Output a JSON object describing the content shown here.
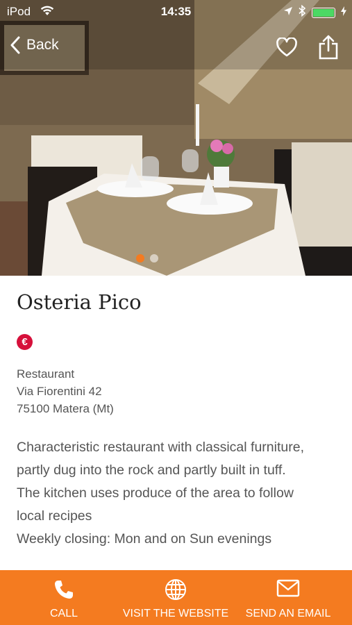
{
  "status_bar": {
    "carrier": "iPod",
    "time": "14:35"
  },
  "nav": {
    "back_label": "Back",
    "heart_icon": "heart-outline-icon",
    "share_icon": "share-icon"
  },
  "gallery": {
    "page_count": 2,
    "active_index": 0,
    "accent_color": "#f47b20"
  },
  "place": {
    "name": "Osteria Pico",
    "price_symbol": "€",
    "category": "Restaurant",
    "street": "Via Fiorentini 42",
    "city": "75100 Matera (Mt)",
    "description_lines": [
      "Characteristic restaurant with classical furniture,",
      "partly dug into the rock and partly built in tuff.",
      "The kitchen uses produce of the area to follow",
      "local recipes",
      "Weekly closing: Mon and on Sun evenings"
    ]
  },
  "bottom_bar": {
    "background": "#f47b20",
    "call_label": "CALL",
    "website_label": "VISIT THE WEBSITE",
    "email_label": "SEND AN EMAIL"
  }
}
